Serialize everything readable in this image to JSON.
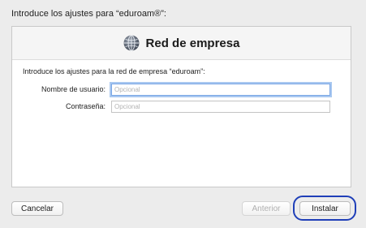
{
  "window": {
    "prompt": "Introduce los ajustes para “eduroam®”:"
  },
  "panel": {
    "title": "Red de empresa",
    "icon": "globe-icon",
    "intro_text": "Introduce los ajustes para la red de empresa “eduroam”:"
  },
  "form": {
    "username_label": "Nombre de usuario:",
    "username_value": "",
    "username_placeholder": "Opcional",
    "password_label": "Contraseña:",
    "password_value": "",
    "password_placeholder": "Opcional"
  },
  "footer": {
    "cancel_label": "Cancelar",
    "previous_label": "Anterior",
    "install_label": "Instalar"
  },
  "colors": {
    "highlight_ring": "#1f3fb8",
    "focus_ring": "#a9c8f0"
  }
}
